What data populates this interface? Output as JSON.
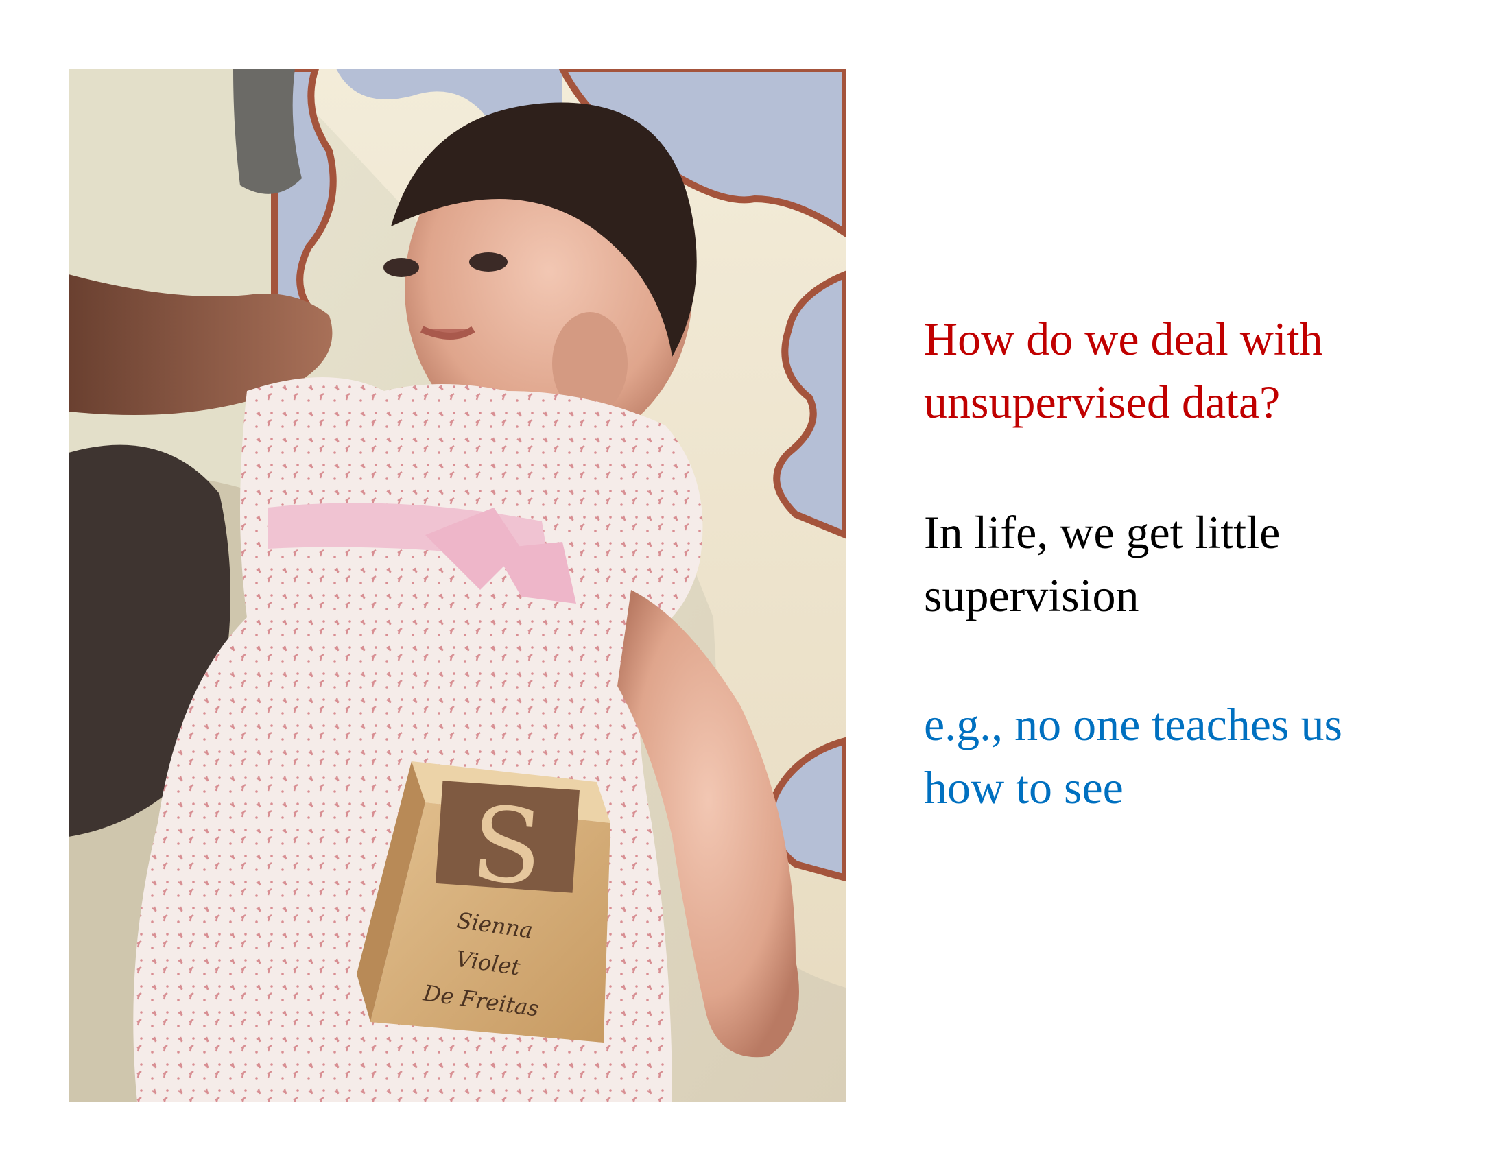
{
  "colors": {
    "question": "#c00000",
    "statement": "#000000",
    "example": "#0070c0",
    "background": "#ffffff"
  },
  "text": {
    "question": [
      "How do we deal with",
      "unsupervised data?"
    ],
    "statement": [
      "In life, we get little",
      "supervision"
    ],
    "example": [
      "e.g., no one teaches us",
      "how to see"
    ]
  },
  "photo": {
    "block_letter": "S",
    "block_inscription": [
      "Sienna",
      "Violet",
      "De Freitas"
    ]
  }
}
